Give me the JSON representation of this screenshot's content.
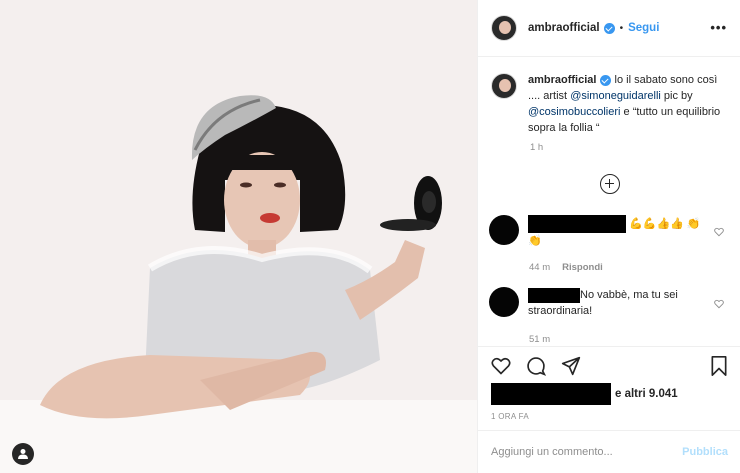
{
  "post": {
    "username": "ambraofficial",
    "dot": "•",
    "follow_label": "Segui",
    "more_label": "•••"
  },
  "caption": {
    "username": "ambraofficial",
    "text_1": " lo il sabato sono così .... artist ",
    "mention_1": "@simoneguidarelli",
    "text_2": " pic by ",
    "mention_2": "@cosimobuccolieri",
    "text_3": " e “tutto un equilibrio sopra la follia “",
    "time": "1 h"
  },
  "comments": [
    {
      "emoji": "💪💪👍👍 👏👏",
      "time": "44 m",
      "reply_label": "Rispondi"
    },
    {
      "text": "No vabbè, ma tu sei straordinaria!",
      "time": "51 m"
    }
  ],
  "likes": {
    "text": "e altri 9.041"
  },
  "post_time": "1 ORA FA",
  "comment_box": {
    "placeholder": "Aggiungi un commento...",
    "publish_label": "Pubblica"
  },
  "colors": {
    "accent": "#3897f0",
    "publish_disabled": "#b2dffc",
    "muted": "#8e8e8e"
  },
  "icons": [
    "user-tag-icon",
    "verified-icon",
    "more-icon",
    "add-circle-icon",
    "heart-icon",
    "comment-icon",
    "share-icon",
    "bookmark-icon"
  ]
}
